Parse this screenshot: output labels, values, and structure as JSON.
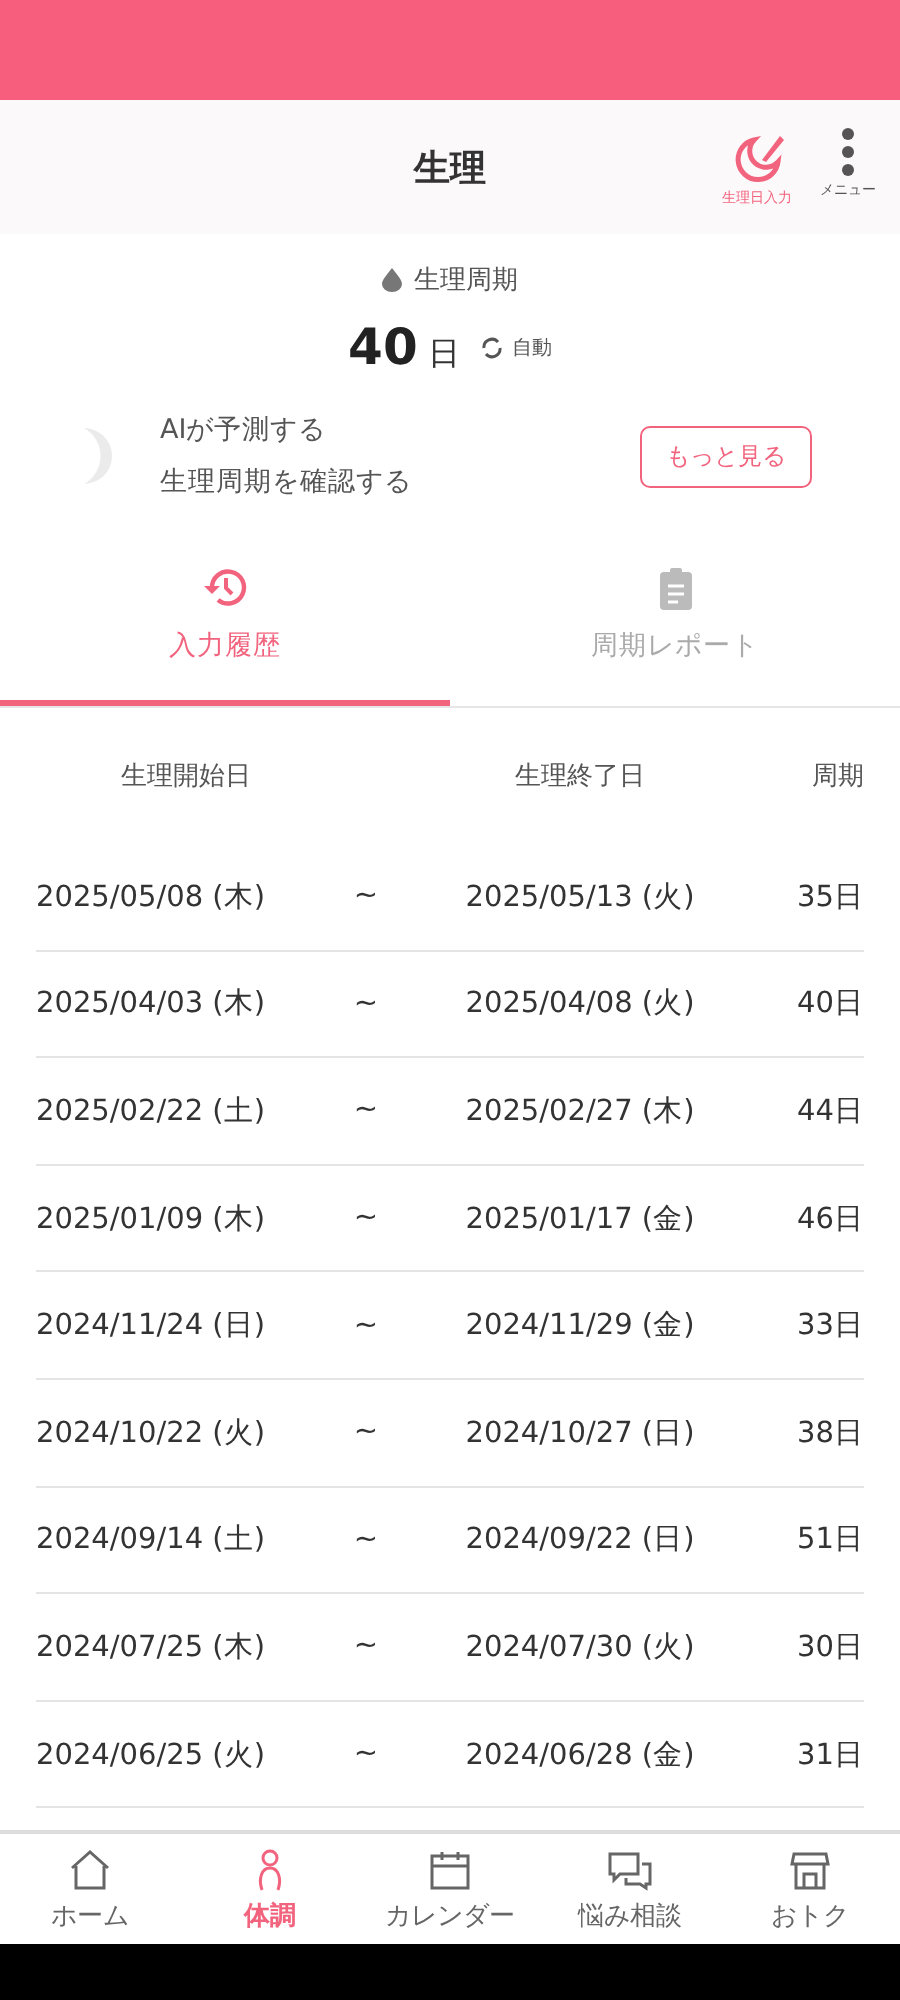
{
  "header": {
    "title": "生理",
    "actions": [
      {
        "kind": "record",
        "label": "生理日入力"
      },
      {
        "kind": "menu",
        "label": "メニュー"
      }
    ]
  },
  "summary": {
    "label": "生理周期",
    "value": "40",
    "unit": "日",
    "mode": "自動"
  },
  "ai_banner": {
    "lines": [
      "AIが予測する",
      "生理周期を確認する"
    ],
    "button": "もっと見る"
  },
  "tabs": [
    {
      "kind": "history",
      "label": "入力履歴",
      "selected": true
    },
    {
      "kind": "report",
      "label": "周期レポート",
      "selected": false
    }
  ],
  "table": {
    "columns": [
      "生理開始日",
      "生理終了日",
      "周期"
    ],
    "separator": "~",
    "rows": [
      {
        "start": "2025/05/08 (木)",
        "end": "2025/05/13 (火)",
        "cycle": "35日"
      },
      {
        "start": "2025/04/03 (木)",
        "end": "2025/04/08 (火)",
        "cycle": "40日"
      },
      {
        "start": "2025/02/22 (土)",
        "end": "2025/02/27 (木)",
        "cycle": "44日"
      },
      {
        "start": "2025/01/09 (木)",
        "end": "2025/01/17 (金)",
        "cycle": "46日"
      },
      {
        "start": "2024/11/24 (日)",
        "end": "2024/11/29 (金)",
        "cycle": "33日"
      },
      {
        "start": "2024/10/22 (火)",
        "end": "2024/10/27 (日)",
        "cycle": "38日"
      },
      {
        "start": "2024/09/14 (土)",
        "end": "2024/09/22 (日)",
        "cycle": "51日"
      },
      {
        "start": "2024/07/25 (木)",
        "end": "2024/07/30 (火)",
        "cycle": "30日"
      },
      {
        "start": "2024/06/25 (火)",
        "end": "2024/06/28 (金)",
        "cycle": "31日"
      }
    ]
  },
  "bottom_nav": [
    {
      "kind": "home",
      "label": "ホーム",
      "selected": false
    },
    {
      "kind": "body",
      "label": "体調",
      "selected": true
    },
    {
      "kind": "calendar",
      "label": "カレンダー",
      "selected": false
    },
    {
      "kind": "chat",
      "label": "悩み相談",
      "selected": false
    },
    {
      "kind": "shop",
      "label": "おトク",
      "selected": false
    }
  ]
}
